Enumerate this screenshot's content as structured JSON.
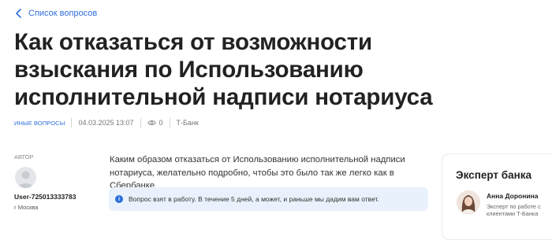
{
  "back_link": {
    "label": "Список вопросов",
    "icon": "chevron-left-icon"
  },
  "title": "Как отказаться от возможности взыскания по Использованию исполнительной надписи нотариуса",
  "meta": {
    "category": "Иные вопросы",
    "date": "04.03.2025 13:07",
    "views": "0",
    "bank": "Т-Банк"
  },
  "author": {
    "label": "Автор",
    "name": "User-725013333783",
    "city": "г Москва"
  },
  "question_text": "Каким образом отказаться от Использованию исполнительной надписи нотариуса, желательно подробно, чтобы это было так же легко как в Сбербанке.",
  "info_message": "Вопрос взят в работу. В течение 5 дней, а может, и раньше мы дадим вам ответ.",
  "expert": {
    "title": "Эксперт банка",
    "name": "Анна Доронина",
    "role": "Эксперт по работе с клиентами Т-Банка"
  },
  "colors": {
    "accent": "#2f6fdc",
    "info_bg": "#e9f2fc"
  }
}
